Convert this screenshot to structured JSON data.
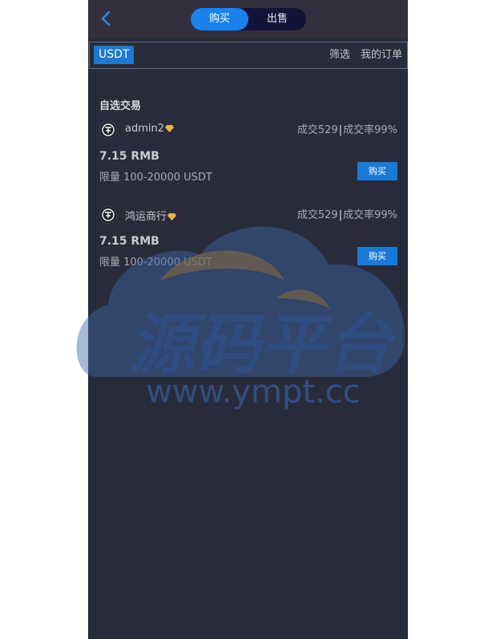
{
  "header": {
    "back_icon": "chevron-left-icon",
    "tabs": [
      {
        "label": "购买",
        "active": true
      },
      {
        "label": "出售",
        "active": false
      }
    ]
  },
  "filter": {
    "coin": "USDT",
    "filter_label": "筛选",
    "my_orders_label": "我的订单"
  },
  "section_title": "自选交易",
  "items": [
    {
      "name": "admin2",
      "stats_left": "成交529",
      "stats_right": "成交率99%",
      "price": "7.15 RMB",
      "limit": "限量 100-20000 USDT",
      "buy_label": "购买"
    },
    {
      "name": "鸿运商行",
      "stats_left": "成交529",
      "stats_right": "成交率99%",
      "price": "7.15 RMB",
      "limit": "限量 100-20000 USDT",
      "buy_label": "购买"
    }
  ],
  "watermark": {
    "title": "源码平台",
    "url": "www.ympt.cc"
  },
  "colors": {
    "accent": "#1a82ec",
    "background": "#282c3a",
    "header_bg": "#342f3f",
    "diamond": "#f1b43c"
  }
}
